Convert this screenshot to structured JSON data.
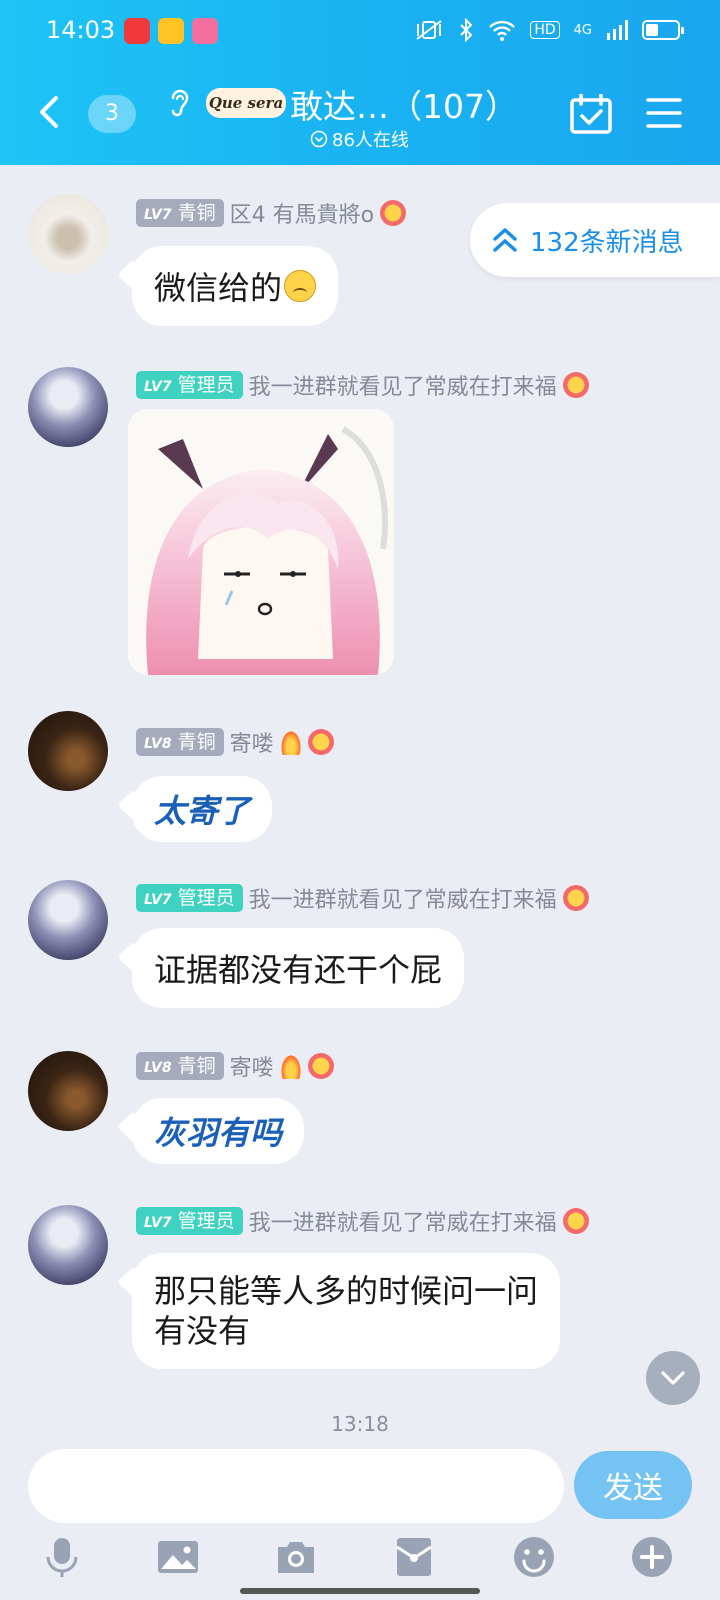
{
  "status_bar": {
    "time": "14:03",
    "network": "4G",
    "hd_label": "HD"
  },
  "header": {
    "unread_count": "3",
    "logo_text": "Que sera",
    "group_title": "敢达…（107）",
    "online_text": "86人在线"
  },
  "new_messages_pill": {
    "label": "132条新消息"
  },
  "messages": [
    {
      "level": "LV7",
      "rank": "青铜",
      "nickname": "区4 有馬貴將o",
      "text": "微信给的"
    },
    {
      "level": "LV7",
      "rank": "管理员",
      "nickname": "我一进群就看见了常威在打来福"
    },
    {
      "level": "LV8",
      "rank": "青铜",
      "nickname": "寄喽",
      "text": "太寄了"
    },
    {
      "level": "LV7",
      "rank": "管理员",
      "nickname": "我一进群就看见了常威在打来福",
      "text": "证据都没有还干个屁"
    },
    {
      "level": "LV8",
      "rank": "青铜",
      "nickname": "寄喽",
      "text": "灰羽有吗"
    },
    {
      "level": "LV7",
      "rank": "管理员",
      "nickname": "我一进群就看见了常威在打来福",
      "text_line1": "那只能等人多的时候问一问",
      "text_line2": "有没有"
    }
  ],
  "timestamp": "13:18",
  "composer": {
    "placeholder": "",
    "send_label": "发送"
  },
  "colors": {
    "header_gradient_start": "#1ec4f6",
    "header_gradient_end": "#1aa6ee",
    "chat_background": "#ebedf5",
    "admin_badge": "#3fd2c0",
    "level_badge": "#a5abbd",
    "send_button": "#74c3f2",
    "accent_blue": "#1a8ee8"
  },
  "icons": [
    "back-icon",
    "ear-icon",
    "calendar-check-icon",
    "menu-icon",
    "double-chevron-up-icon",
    "chevron-down-icon",
    "microphone-icon",
    "image-icon",
    "camera-icon",
    "red-packet-icon",
    "emoji-icon",
    "plus-icon"
  ]
}
